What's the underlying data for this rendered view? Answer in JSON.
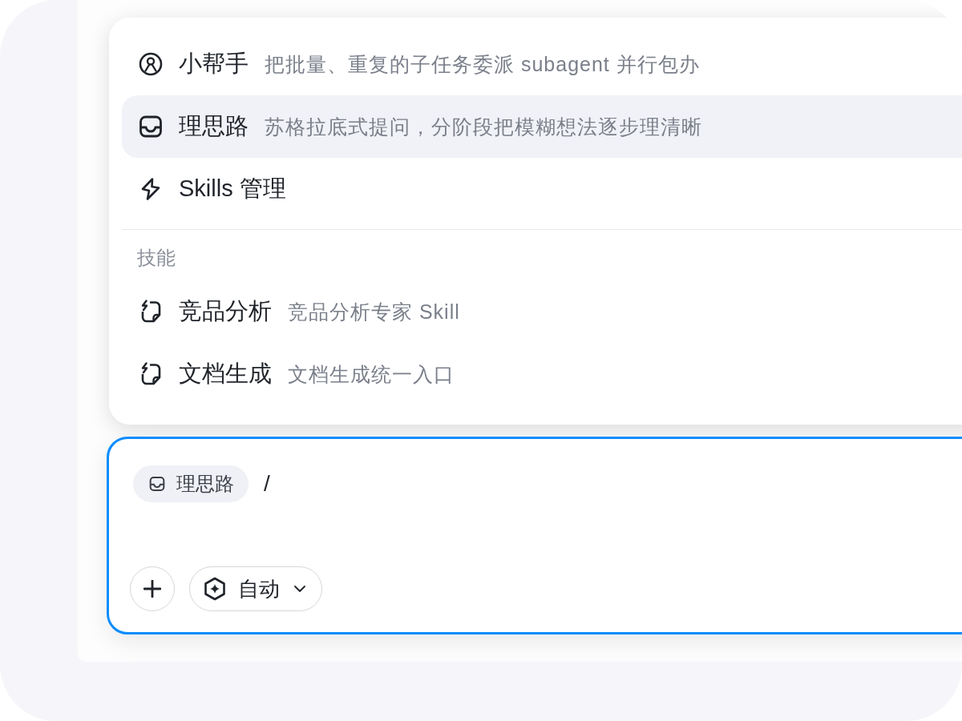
{
  "menu": {
    "commands": [
      {
        "kind": "agent",
        "label": "小帮手",
        "description": "把批量、重复的子任务委派 subagent 并行包办",
        "selected": false
      },
      {
        "kind": "mode",
        "label": "理思路",
        "description": "苏格拉底式提问，分阶段把模糊想法逐步理清晰",
        "selected": true
      },
      {
        "kind": "manage",
        "label": "Skills 管理",
        "selected": false
      }
    ],
    "sections": [
      {
        "title": "技能",
        "items": [
          {
            "kind": "skill",
            "label": "竞品分析",
            "description": "竞品分析专家 Skill",
            "selected": false
          },
          {
            "kind": "skill",
            "label": "文档生成",
            "description": "文档生成统一入口",
            "selected": false
          }
        ]
      }
    ]
  },
  "composer": {
    "chip": {
      "kind": "mode",
      "label": "理思路"
    },
    "value": "/",
    "mode_selector": {
      "label": "自动"
    }
  }
}
